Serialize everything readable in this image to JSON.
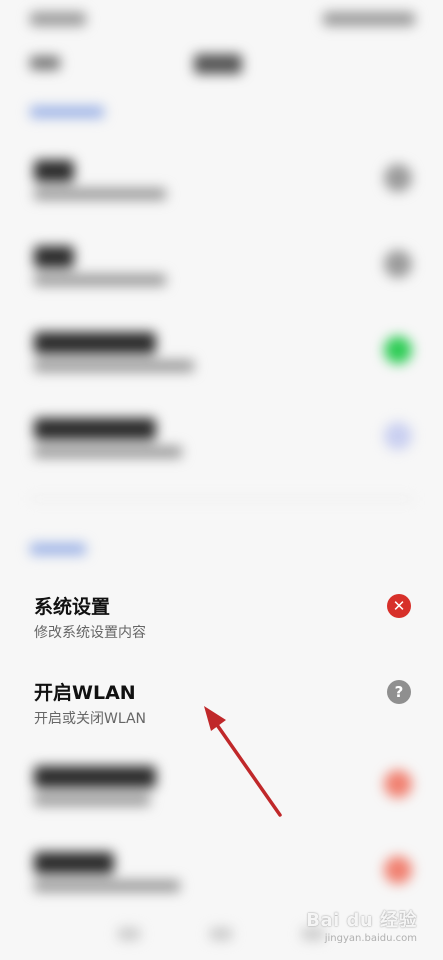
{
  "colors": {
    "denied": "#d7302a",
    "ask": "#8f8f8f",
    "toggle_on": "#2ecc55",
    "arrow": "#c0282a",
    "accent_blue": "#9db3e6"
  },
  "permissions": [
    {
      "title": "系统设置",
      "subtitle": "修改系统设置内容",
      "status_icon": "close-circle-icon",
      "status_glyph": "✕"
    },
    {
      "title": "开启WLAN",
      "subtitle": "开启或关闭WLAN",
      "status_icon": "question-circle-icon",
      "status_glyph": "?"
    }
  ],
  "watermark": {
    "logo": "Bai du 经验",
    "url": "jingyan.baidu.com"
  }
}
